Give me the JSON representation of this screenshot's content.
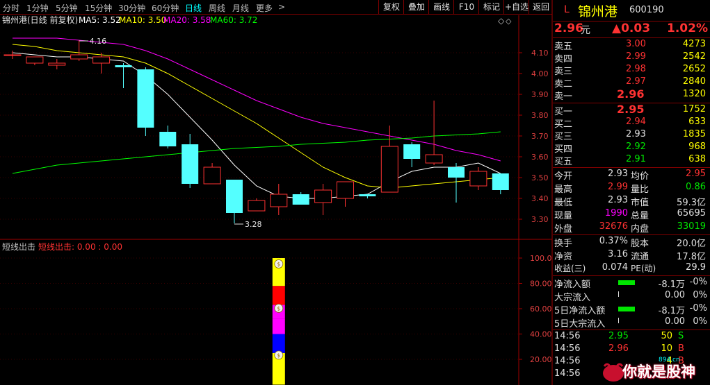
{
  "toolbar": {
    "periods": [
      "分时",
      "1分钟",
      "5分钟",
      "15分钟",
      "30分钟",
      "60分钟",
      "日线",
      "周线",
      "月线",
      "更多"
    ],
    "more_arrow": ">",
    "buttons": [
      "复权",
      "叠加",
      "画线",
      "F10",
      "标记",
      "+自选",
      "返回"
    ]
  },
  "main_chart": {
    "title": "锦州港(日线 前复权)",
    "ma": [
      {
        "label": "MA5: 3.52",
        "color": "#ffffff"
      },
      {
        "label": "MA10: 3.50",
        "color": "#ffff00"
      },
      {
        "label": "MA20: 3.58",
        "color": "#ff00ff"
      },
      {
        "label": "MA60: 3.72",
        "color": "#00ff00"
      }
    ],
    "high_label": "4.16",
    "low_label": "3.28",
    "diamond": "◇"
  },
  "sub_chart": {
    "title": "短线出击",
    "indicator_label": "短线出击: 0.00 : 0.00",
    "axis_labels": [
      "100.0",
      "80.00",
      "60.00",
      "40.00",
      "20.00"
    ]
  },
  "chart_data": [
    {
      "type": "candlestick",
      "title": "锦州港(日线 前复权)",
      "ylim": [
        3.22,
        4.22
      ],
      "y_ticks": [
        4.1,
        4.0,
        3.9,
        3.8,
        3.7,
        3.6,
        3.5,
        3.4,
        3.3
      ],
      "y_tick_labels": [
        "4.10",
        "4.00",
        "3.90",
        "3.80",
        "3.70",
        "3.60",
        "3.50",
        "3.40",
        "3.30"
      ],
      "candles": [
        {
          "o": 4.09,
          "h": 4.11,
          "l": 4.07,
          "c": 4.09
        },
        {
          "o": 4.05,
          "h": 4.08,
          "l": 4.04,
          "c": 4.08
        },
        {
          "o": 4.04,
          "h": 4.07,
          "l": 4.02,
          "c": 4.05
        },
        {
          "o": 4.07,
          "h": 4.16,
          "l": 4.06,
          "c": 4.09
        },
        {
          "o": 4.05,
          "h": 4.1,
          "l": 4.0,
          "c": 4.08
        },
        {
          "o": 4.04,
          "h": 4.05,
          "l": 3.93,
          "c": 4.03
        },
        {
          "o": 4.02,
          "h": 4.03,
          "l": 3.7,
          "c": 3.74
        },
        {
          "o": 3.72,
          "h": 3.75,
          "l": 3.64,
          "c": 3.65
        },
        {
          "o": 3.66,
          "h": 3.71,
          "l": 3.45,
          "c": 3.47
        },
        {
          "o": 3.47,
          "h": 3.57,
          "l": 3.47,
          "c": 3.55
        },
        {
          "o": 3.49,
          "h": 3.49,
          "l": 3.28,
          "c": 3.33
        },
        {
          "o": 3.34,
          "h": 3.4,
          "l": 3.34,
          "c": 3.39
        },
        {
          "o": 3.36,
          "h": 3.47,
          "l": 3.32,
          "c": 3.42
        },
        {
          "o": 3.42,
          "h": 3.43,
          "l": 3.37,
          "c": 3.37
        },
        {
          "o": 3.38,
          "h": 3.47,
          "l": 3.32,
          "c": 3.44
        },
        {
          "o": 3.4,
          "h": 3.48,
          "l": 3.36,
          "c": 3.48
        },
        {
          "o": 3.42,
          "h": 3.42,
          "l": 3.4,
          "c": 3.41
        },
        {
          "o": 3.43,
          "h": 3.75,
          "l": 3.43,
          "c": 3.65
        },
        {
          "o": 3.66,
          "h": 3.67,
          "l": 3.55,
          "c": 3.59
        },
        {
          "o": 3.57,
          "h": 3.87,
          "l": 3.56,
          "c": 3.61
        },
        {
          "o": 3.55,
          "h": 3.57,
          "l": 3.38,
          "c": 3.5
        },
        {
          "o": 3.46,
          "h": 3.55,
          "l": 3.44,
          "c": 3.53
        },
        {
          "o": 3.52,
          "h": 3.52,
          "l": 3.42,
          "c": 3.44
        }
      ],
      "series": [
        {
          "name": "MA5",
          "color": "#ffffff",
          "values": [
            4.1,
            4.09,
            4.08,
            4.08,
            4.07,
            4.06,
            3.99,
            3.9,
            3.79,
            3.68,
            3.56,
            3.46,
            3.41,
            3.4,
            3.4,
            3.41,
            3.42,
            3.48,
            3.53,
            3.55,
            3.55,
            3.57,
            3.52
          ]
        },
        {
          "name": "MA10",
          "color": "#ffff00",
          "values": [
            4.14,
            4.13,
            4.11,
            4.1,
            4.09,
            4.08,
            4.05,
            4.0,
            3.94,
            3.88,
            3.82,
            3.76,
            3.69,
            3.62,
            3.55,
            3.5,
            3.46,
            3.45,
            3.46,
            3.47,
            3.48,
            3.49,
            3.5
          ]
        },
        {
          "name": "MA20",
          "color": "#ff00ff",
          "values": [
            4.17,
            4.17,
            4.17,
            4.16,
            4.15,
            4.14,
            4.11,
            4.07,
            4.02,
            3.97,
            3.92,
            3.87,
            3.83,
            3.79,
            3.76,
            3.74,
            3.72,
            3.7,
            3.68,
            3.66,
            3.63,
            3.61,
            3.58
          ]
        },
        {
          "name": "MA60",
          "color": "#00ff00",
          "values": [
            3.52,
            3.54,
            3.56,
            3.57,
            3.58,
            3.59,
            3.6,
            3.61,
            3.62,
            3.63,
            3.64,
            3.645,
            3.65,
            3.66,
            3.665,
            3.67,
            3.68,
            3.685,
            3.69,
            3.7,
            3.705,
            3.71,
            3.72
          ]
        }
      ]
    },
    {
      "type": "bar",
      "title": "短线出击",
      "ylim": [
        0,
        100
      ],
      "y_ticks": [
        100,
        80,
        60,
        40,
        20
      ],
      "bar_index": 12,
      "bar_segments": [
        {
          "from": 0,
          "to": 25,
          "color": "#ffff00"
        },
        {
          "from": 25,
          "to": 40,
          "color": "#0000ff"
        },
        {
          "from": 40,
          "to": 52,
          "color": "#ff00ff"
        },
        {
          "from": 52,
          "to": 63,
          "color": "#ff00ff"
        },
        {
          "from": 63,
          "to": 78,
          "color": "#ff0000"
        },
        {
          "from": 78,
          "to": 100,
          "color": "#ffff00"
        }
      ],
      "coin_levels": [
        97,
        62,
        25
      ]
    }
  ],
  "quote": {
    "prefix": "L",
    "name": "锦州港",
    "code": "600190",
    "price": "2.96",
    "price_unit": "元",
    "change": "▲0.03",
    "change_pct": "1.02%",
    "sells": [
      {
        "label": "卖五",
        "price": "3.00",
        "vol": "4273"
      },
      {
        "label": "卖四",
        "price": "2.99",
        "vol": "2542"
      },
      {
        "label": "卖三",
        "price": "2.98",
        "vol": "2652"
      },
      {
        "label": "卖二",
        "price": "2.97",
        "vol": "2840"
      },
      {
        "label": "卖一",
        "price": "2.96",
        "vol": "1320"
      }
    ],
    "buys": [
      {
        "label": "买一",
        "price": "2.95",
        "vol": "1752"
      },
      {
        "label": "买二",
        "price": "2.94",
        "vol": "633"
      },
      {
        "label": "买三",
        "price": "2.93",
        "vol": "1835"
      },
      {
        "label": "买四",
        "price": "2.92",
        "vol": "968"
      },
      {
        "label": "买五",
        "price": "2.91",
        "vol": "638"
      }
    ],
    "stats": [
      {
        "l1": "今开",
        "v1": "2.93",
        "l2": "均价",
        "v2": "2.95"
      },
      {
        "l1": "最高",
        "v1": "2.99",
        "l2": "量比",
        "v2": "0.86"
      },
      {
        "l1": "最低",
        "v1": "2.93",
        "l2": "市值",
        "v2": "59.3亿"
      },
      {
        "l1": "现量",
        "v1": "1990",
        "l2": "总量",
        "v2": "65695"
      },
      {
        "l1": "外盘",
        "v1": "32676",
        "l2": "内盘",
        "v2": "33019"
      }
    ],
    "fund": [
      {
        "l1": "换手",
        "v1": "0.37%",
        "l2": "股本",
        "v2": "20.0亿"
      },
      {
        "l1": "净资",
        "v1": "3.16",
        "l2": "流通",
        "v2": "17.8亿"
      },
      {
        "l1": "收益(三)",
        "v1": "0.074",
        "l2": "PE(动)",
        "v2": "29.9"
      }
    ],
    "flow": [
      {
        "label": "净流入额",
        "value": "-8.1万",
        "pct": "-0%",
        "bar": true
      },
      {
        "label": "大宗流入",
        "value": "0.00",
        "pct": "0%",
        "bar": false
      },
      {
        "label": "5日净流入额",
        "value": "-8.1万",
        "pct": "-0%",
        "bar": true
      },
      {
        "label": "5日大宗流入",
        "value": "0.00",
        "pct": "0%",
        "bar": false
      }
    ],
    "ticks": [
      {
        "time": "14:56",
        "price": "2.95",
        "vol": "50",
        "side": "S"
      },
      {
        "time": "14:56",
        "price": "2.96",
        "vol": "10",
        "side": "B"
      },
      {
        "time": "14:56",
        "price": "",
        "vol": "4",
        "side": "B"
      },
      {
        "time": "14:56",
        "price": "",
        "vol": "",
        "side": ""
      }
    ],
    "watermark": "你就是股神",
    "watermark_small": "894.cn"
  }
}
